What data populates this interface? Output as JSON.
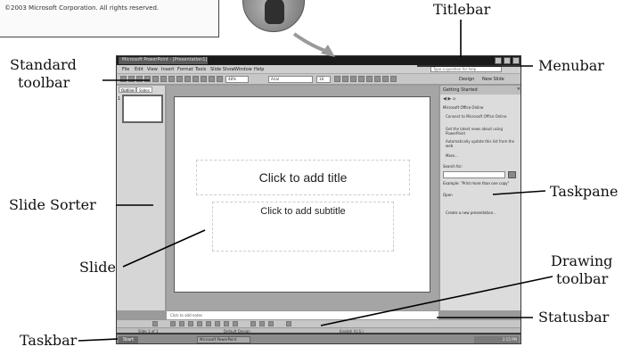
{
  "splash": {
    "text": "©2003 Microsoft Corporation. All rights reserved."
  },
  "callouts": {
    "titlebar": "Titlebar",
    "standard_toolbar_line1": "Standard",
    "standard_toolbar_line2": "toolbar",
    "menubar": "Menubar",
    "slide_sorter": "Slide  Sorter",
    "taskpane": "Taskpane",
    "slide": "Slide",
    "drawing_toolbar_line1": "Drawing",
    "drawing_toolbar_line2": "toolbar",
    "statusbar": "Statusbar",
    "taskbar": "Taskbar"
  },
  "window": {
    "title": "Microsoft PowerPoint - [Presentation1]",
    "menu": [
      "File",
      "Edit",
      "View",
      "Insert",
      "Format",
      "Tools",
      "Slide Show",
      "Window",
      "Help"
    ],
    "ask_placeholder": "Type a question for help",
    "zoom": "48%",
    "font": "Arial",
    "font_size": "18",
    "design_label": "Design",
    "new_slide_label": "New Slide"
  },
  "left_pane": {
    "tabs": [
      "Outline",
      "Slides"
    ],
    "thumb_number": "1"
  },
  "slide": {
    "title_placeholder": "Click to add title",
    "subtitle_placeholder": "Click to add subtitle"
  },
  "notes": {
    "placeholder": "Click to add notes"
  },
  "taskpane": {
    "title": "Getting Started",
    "office_online": "Microsoft Office Online",
    "bullets": [
      "Connect to Microsoft Office Online",
      "Get the latest news about using PowerPoint",
      "Automatically update this list from the web"
    ],
    "more": "More...",
    "search_label": "Search for:",
    "example": "Example: \"Print more than one copy\"",
    "open_section": "Open",
    "open_item": "Create a new presentation..."
  },
  "statusbar": {
    "slide_count": "Slide 1 of 1",
    "design": "Default Design",
    "language": "English (U.S.)"
  },
  "taskbar": {
    "start": "Start",
    "tasks": [
      "Microsoft PowerPoint"
    ],
    "clock": "2:15 PM"
  }
}
